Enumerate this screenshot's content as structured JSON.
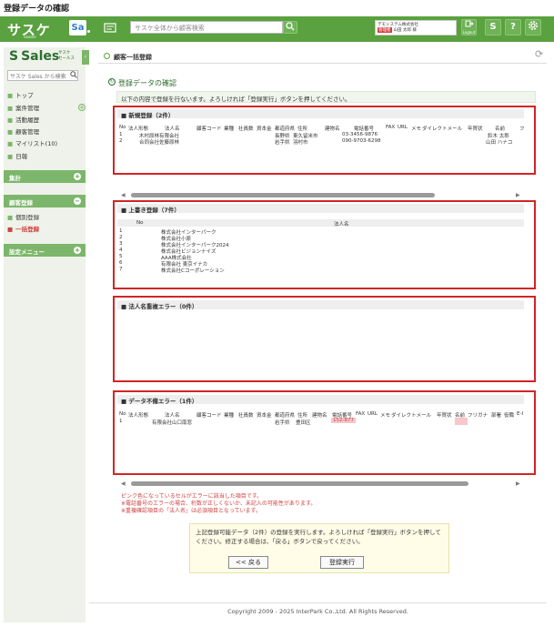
{
  "window_caption": "登録データの確認",
  "header": {
    "logo_text": "サスケ",
    "logo_sub": "saaske",
    "sa_badge": "Sa",
    "search_placeholder": "サスケ全体から顧客検索",
    "user_company": "デモシステム株式会社",
    "user_tag": "管理者",
    "user_name": "山田 太郎 様",
    "logout_label": "Logout",
    "help_label": "?",
    "brand_color": "#5aa13f"
  },
  "sidebar": {
    "logo": "Sales",
    "logo_sub1": "サスケ",
    "logo_sub2": "セールス",
    "search_placeholder": "サスケ Sales から検索",
    "items": [
      {
        "label": "トップ"
      },
      {
        "label": "案件管理"
      },
      {
        "label": "活動履歴"
      },
      {
        "label": "顧客管理"
      },
      {
        "label": "マイリスト(10)"
      },
      {
        "label": "日報"
      }
    ],
    "section_aggregate": "集計",
    "section_customer": "顧客登録",
    "customer_items": [
      {
        "label": "個別登録"
      },
      {
        "label": "一括登録"
      }
    ],
    "section_settings": "設定メニュー"
  },
  "content": {
    "header_title": "顧客一括登録",
    "page_title": "登録データの確認",
    "info_text": "以下の内容で登録を行ないます。よろしければ「登録実行」ボタンを押してください。"
  },
  "new_reg": {
    "title": "新規登録（2件）",
    "columns": [
      "No",
      "法人形態",
      "法人名",
      "顧客コード",
      "業種",
      "社員数",
      "資本金",
      "都道府県",
      "住所",
      "建物名",
      "電話番号",
      "FAX",
      "URL",
      "メモ",
      "ダイレクトメール",
      "年賀状",
      "名前",
      "フ"
    ],
    "rows": [
      {
        "no": "1",
        "name": "木村原林有限会社",
        "pref": "長野県",
        "addr": "東久留米市",
        "tel": "03-3456-9876",
        "person": "鈴木 太郎"
      },
      {
        "no": "2",
        "name": "合同会社佐藤原林",
        "pref": "岩手県",
        "addr": "羽村市",
        "tel": "090-9703-6298",
        "person": "山田 ハナコ"
      }
    ]
  },
  "overwrite": {
    "title": "上書き登録（7件）",
    "col_no": "No",
    "col_name": "法人名",
    "rows": [
      {
        "no": "1",
        "name": "株式会社インターパーク"
      },
      {
        "no": "2",
        "name": "株式会社小原"
      },
      {
        "no": "3",
        "name": "株式会社インターパーク2024"
      },
      {
        "no": "4",
        "name": "株式会社ビジョンナイズ"
      },
      {
        "no": "5",
        "name": "AAA株式会社"
      },
      {
        "no": "6",
        "name": "有限会社 東京イナカ"
      },
      {
        "no": "7",
        "name": "株式会社Cコーポレーション"
      }
    ]
  },
  "dup_error": {
    "title": "法人名重複エラー（0件）"
  },
  "data_error": {
    "title": "データ不備エラー（1件）",
    "columns": [
      "No",
      "法人形態",
      "法人名",
      "顧客コード",
      "業種",
      "社員数",
      "資本金",
      "都道府県",
      "住所",
      "建物名",
      "電話番号",
      "FAX",
      "URL",
      "メモ",
      "ダイレクトメール",
      "年賀状",
      "名前",
      "フリガナ",
      "部署",
      "役職",
      "E-I"
    ],
    "row": {
      "no": "1",
      "name": "有限会社山口南窓",
      "pref": "岩手県",
      "addr": "豊田区",
      "tel": "152-877"
    }
  },
  "notes": [
    "ピンク色になっているセルがエラーに該当した項目です。",
    "※電話番号のエラーの場合、桁数が正しくないか、未記入の可能性があります。",
    "※重複確認項目の「法人名」は必須項目となっています。"
  ],
  "confirm": {
    "text": "上記登録可能データ（2件）の登録を実行します。よろしければ「登録実行」ボタンを押してください。修正する場合は、「戻る」ボタンで戻ってください。",
    "back_label": "<< 戻る",
    "execute_label": "登録実行"
  },
  "footer": "Copyright 2009 - 2025 InterPark Co.,Ltd. All Rights Reserved."
}
